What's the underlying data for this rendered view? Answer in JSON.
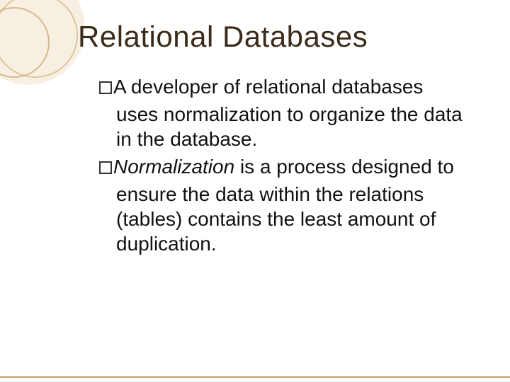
{
  "title": "Relational Databases",
  "bullets": [
    {
      "lead": "A",
      "rest_line1": " developer of relational databases",
      "cont": "uses normalization to organize the data in the database."
    },
    {
      "lead_italic": "Normalization",
      "rest_line1": " is a process designed to",
      "cont": "ensure the data within the relations (tables) contains the least amount of duplication."
    }
  ]
}
